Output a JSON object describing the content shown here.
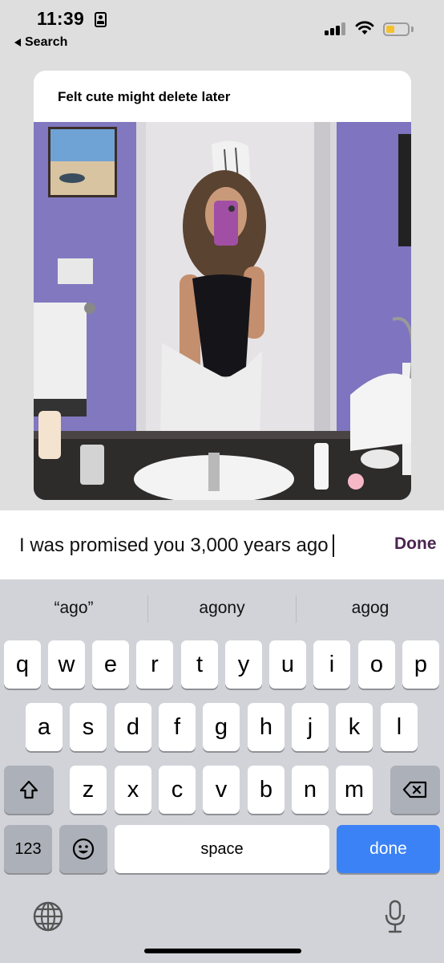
{
  "status_bar": {
    "time": "11:39",
    "back_label": "Search",
    "battery_color": "#f5c12b"
  },
  "post": {
    "caption": "Felt cute might delete later"
  },
  "entry": {
    "text": "I was promised you 3,000 years ago",
    "done_label": "Done",
    "done_color": "#4b2450"
  },
  "keyboard": {
    "suggestions": [
      "“ago”",
      "agony",
      "agog"
    ],
    "row1": [
      "q",
      "w",
      "e",
      "r",
      "t",
      "y",
      "u",
      "i",
      "o",
      "p"
    ],
    "row2": [
      "a",
      "s",
      "d",
      "f",
      "g",
      "h",
      "j",
      "k",
      "l"
    ],
    "row3": [
      "z",
      "x",
      "c",
      "v",
      "b",
      "n",
      "m"
    ],
    "numbers_label": "123",
    "space_label": "space",
    "done_label": "done",
    "done_key_color": "#3b82f6",
    "icons": {
      "shift": "shift-icon",
      "delete": "backspace-icon",
      "emoji": "emoji-icon",
      "globe": "globe-icon",
      "mic": "microphone-icon"
    }
  }
}
